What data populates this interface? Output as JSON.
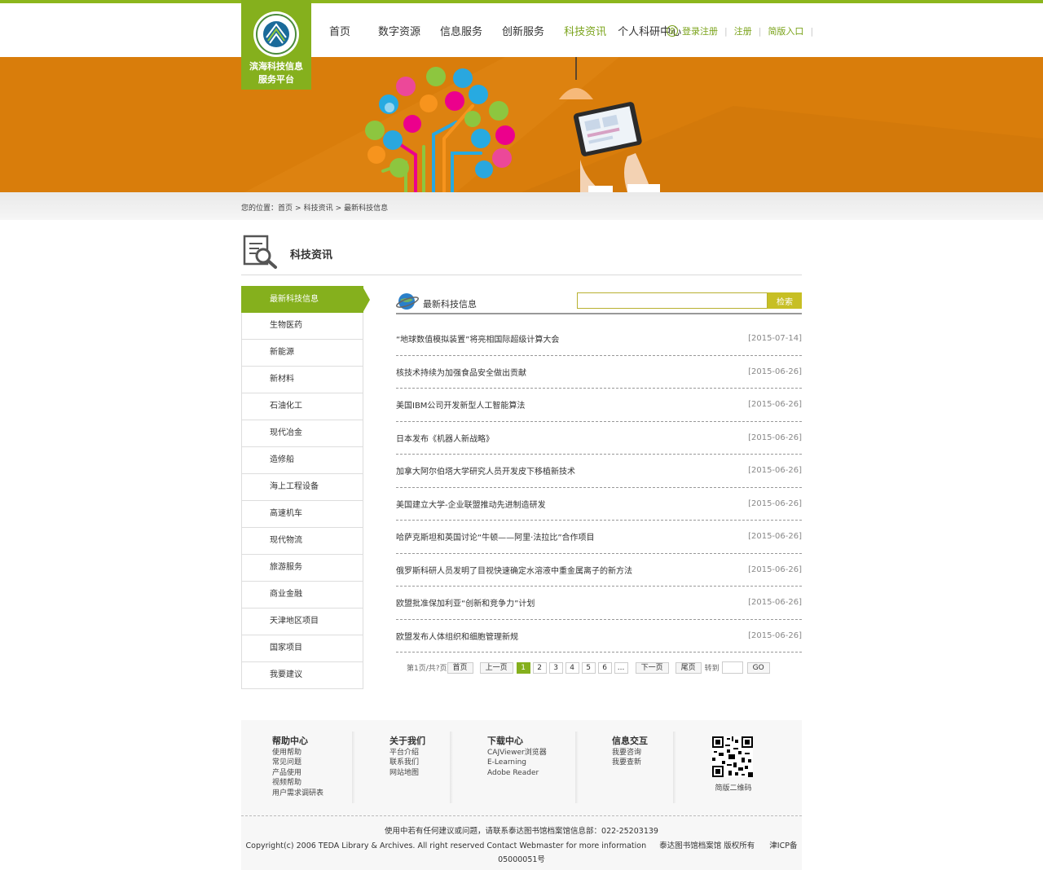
{
  "logo": {
    "title_line1": "滨海科技信息",
    "title_line2": "服务平台"
  },
  "nav": {
    "items": [
      "首页",
      "数字资源",
      "信息服务",
      "创新服务",
      "科技资讯",
      "个人科研中心"
    ],
    "active_index": 4
  },
  "auth": {
    "login": "登录注册",
    "register": "注册",
    "simple": "简版入口"
  },
  "breadcrumb": {
    "prefix": "您的位置：",
    "home": "首页",
    "sep": ">",
    "section": "科技资讯",
    "current": "最新科技信息"
  },
  "section": {
    "title": "科技资讯"
  },
  "sidebar": {
    "items": [
      "最新科技信息",
      "生物医药",
      "新能源",
      "新材料",
      "石油化工",
      "现代冶金",
      "造修船",
      "海上工程设备",
      "高速机车",
      "现代物流",
      "旅游服务",
      "商业金融",
      "天津地区项目",
      "国家项目",
      "我要建议"
    ],
    "active_index": 0
  },
  "main": {
    "title": "最新科技信息",
    "search_button": "检索",
    "search_value": ""
  },
  "news": [
    {
      "title": "“地球数值模拟装置”将亮相国际超级计算大会",
      "date": "[2015-07-14]"
    },
    {
      "title": "核技术持续为加强食品安全做出贡献",
      "date": "[2015-06-26]"
    },
    {
      "title": "美国IBM公司开发新型人工智能算法",
      "date": "[2015-06-26]"
    },
    {
      "title": "日本发布《机器人新战略》",
      "date": "[2015-06-26]"
    },
    {
      "title": "加拿大阿尔伯塔大学研究人员开发皮下移植新技术",
      "date": "[2015-06-26]"
    },
    {
      "title": "美国建立大学-企业联盟推动先进制造研发",
      "date": "[2015-06-26]"
    },
    {
      "title": "哈萨克斯坦和英国讨论“牛顿——阿里·法拉比”合作项目",
      "date": "[2015-06-26]"
    },
    {
      "title": "俄罗斯科研人员发明了目视快速确定水溶液中重金属离子的新方法",
      "date": "[2015-06-26]"
    },
    {
      "title": "欧盟批准保加利亚“创新和竞争力”计划",
      "date": "[2015-06-26]"
    },
    {
      "title": "欧盟发布人体组织和细胞管理新规",
      "date": "[2015-06-26]"
    }
  ],
  "pager": {
    "info": "第1页/共?页",
    "first": "首页",
    "prev": "上一页",
    "pages": [
      "1",
      "2",
      "3",
      "4",
      "5",
      "6",
      "..."
    ],
    "current": "1",
    "next": "下一页",
    "last": "尾页",
    "goto": "转到",
    "go": "GO"
  },
  "footer": {
    "cols": [
      {
        "title": "帮助中心",
        "links": [
          "使用帮助",
          "常见问题",
          "产品使用",
          "视频帮助",
          "用户需求调研表"
        ]
      },
      {
        "title": "关于我们",
        "links": [
          "平台介绍",
          "联系我们",
          "网站地图"
        ]
      },
      {
        "title": "下载中心",
        "links": [
          "CAJViewer浏览器",
          "E-Learning",
          "Adobe Reader"
        ]
      },
      {
        "title": "信息交互",
        "links": [
          "我要咨询",
          "我要查新"
        ]
      }
    ],
    "qr_label": "简版二维码",
    "contact": "使用中若有任何建议或问题，请联系泰达图书馆档案馆信息部：022-25203139",
    "copyright": "Copyright(c) 2006 TEDA Library & Archives. All right reserved Contact Webmaster for more information",
    "owner": "泰达图书馆档案馆 版权所有",
    "icp": "津ICP备",
    "icp_no": "05000051号"
  },
  "colors": {
    "brand_green": "#85b01d",
    "banner_orange": "#d97d0b",
    "search_gold": "#c7bf24"
  }
}
